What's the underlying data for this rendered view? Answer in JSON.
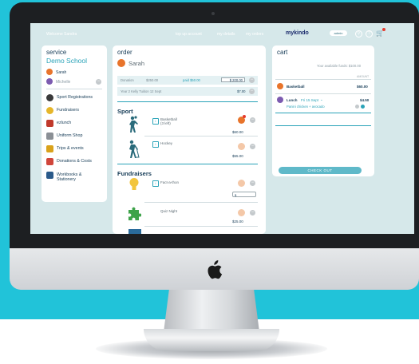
{
  "app": {
    "welcome": "Welcome Sandra",
    "links": [
      "top up account",
      "my details",
      "my orders"
    ],
    "brand": "mykindo",
    "admin": "admin",
    "help_icon": "?",
    "search_icon": "search-icon",
    "cart_icon": "cart-icon"
  },
  "service": {
    "title": "service",
    "school": "Demo School",
    "children": [
      {
        "name": "Sarah",
        "color": "#e8742b"
      },
      {
        "name": "Michelle",
        "color": "#7c5bb0"
      }
    ],
    "items": [
      {
        "label": "Sport Registrations",
        "icon": "soccer-ball-icon",
        "color": "#3a3a3a"
      },
      {
        "label": "Fundraisers",
        "icon": "coins-icon",
        "color": "#e6b62a"
      },
      {
        "label": "ezlunch",
        "icon": "lunchbox-icon",
        "color": "#c0392b"
      },
      {
        "label": "Uniform Shop",
        "icon": "shirt-icon",
        "color": "#8a8f95"
      },
      {
        "label": "Trips & events",
        "icon": "bus-icon",
        "color": "#d9a21b"
      },
      {
        "label": "Donations & Costs",
        "icon": "piggybank-icon",
        "color": "#d0463b"
      },
      {
        "label": "Workbooks & Stationery",
        "icon": "book-icon",
        "color": "#2a5a8a"
      }
    ]
  },
  "order": {
    "title": "order",
    "child": "Sarah",
    "donation": {
      "label": "Donation",
      "amount": "$250.00",
      "paid_label": "paid $50.00",
      "input": "$ 200.00"
    },
    "tuition": {
      "label": "Year 2 Kelly Tuition  12 Sept",
      "amount": "$7.00"
    },
    "sport_title": "Sport",
    "sport_items": [
      {
        "name": "Basketball",
        "note": "(3 left)",
        "price": "$60.00"
      },
      {
        "name": "Hockey",
        "price": "$55.00"
      }
    ],
    "fund_title": "Fundraisers",
    "fund_items": [
      {
        "name": "Fact-a-thon",
        "price": "$"
      },
      {
        "name": "Quiz Night",
        "price": "$25.00"
      }
    ]
  },
  "cart": {
    "title": "cart",
    "funds_label": "Your available funds: $100.00",
    "col_header": "AMOUNT",
    "items": [
      {
        "name": "Basketball",
        "amount": "$60.00"
      },
      {
        "name": "Lunch",
        "date": "Fri 15 Sept",
        "amount": "$4.50",
        "detail": "Panini chicken + avocado"
      }
    ],
    "checkout": "CHECK OUT"
  },
  "colors": {
    "accent": "#2aa3b8",
    "brand_bg": "#21c3d9",
    "orange": "#e8742b"
  }
}
